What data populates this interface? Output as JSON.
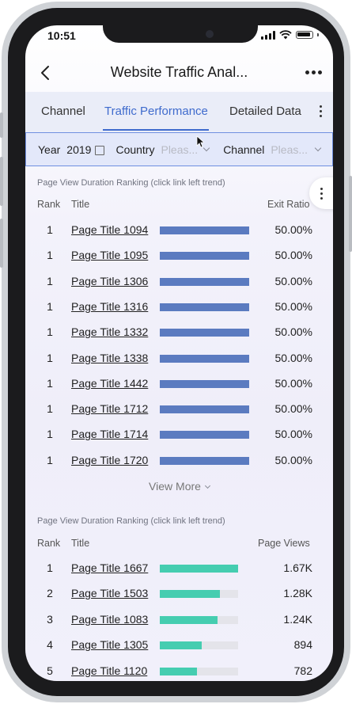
{
  "status_bar": {
    "time": "10:51"
  },
  "nav": {
    "title": "Website Traffic Anal..."
  },
  "tabs": [
    {
      "label": "Channel",
      "active": false
    },
    {
      "label": "Traffic Performance",
      "active": true
    },
    {
      "label": "Detailed Data",
      "active": false
    }
  ],
  "filters": {
    "year_label": "Year",
    "year_value": "2019",
    "country_label": "Country",
    "country_placeholder": "Pleas...",
    "channel_label": "Channel",
    "channel_placeholder": "Pleas..."
  },
  "table1": {
    "caption": "Page View Duration Ranking (click link left trend)",
    "headers": {
      "rank": "Rank",
      "title": "Title",
      "value": "Exit Ratio"
    },
    "bar_color": "#5b7bc0",
    "rows": [
      {
        "rank": "1",
        "title": "Page Title 1094",
        "value": "50.00%",
        "bar": 1.0
      },
      {
        "rank": "1",
        "title": "Page Title 1095",
        "value": "50.00%",
        "bar": 1.0
      },
      {
        "rank": "1",
        "title": "Page Title 1306",
        "value": "50.00%",
        "bar": 1.0
      },
      {
        "rank": "1",
        "title": "Page Title 1316",
        "value": "50.00%",
        "bar": 1.0
      },
      {
        "rank": "1",
        "title": "Page Title 1332",
        "value": "50.00%",
        "bar": 1.0
      },
      {
        "rank": "1",
        "title": "Page Title 1338",
        "value": "50.00%",
        "bar": 1.0
      },
      {
        "rank": "1",
        "title": "Page Title 1442",
        "value": "50.00%",
        "bar": 1.0
      },
      {
        "rank": "1",
        "title": "Page Title 1712",
        "value": "50.00%",
        "bar": 1.0
      },
      {
        "rank": "1",
        "title": "Page Title 1714",
        "value": "50.00%",
        "bar": 1.0
      },
      {
        "rank": "1",
        "title": "Page Title 1720",
        "value": "50.00%",
        "bar": 1.0
      }
    ],
    "view_more": "View More"
  },
  "table2": {
    "caption": "Page View Duration Ranking (click link left trend)",
    "headers": {
      "rank": "Rank",
      "title": "Title",
      "value": "Page Views"
    },
    "bar_color": "#45cdb0",
    "rows": [
      {
        "rank": "1",
        "title": "Page Title 1667",
        "value": "1.67K",
        "bar": 1.0
      },
      {
        "rank": "2",
        "title": "Page Title 1503",
        "value": "1.28K",
        "bar": 0.77
      },
      {
        "rank": "3",
        "title": "Page Title 1083",
        "value": "1.24K",
        "bar": 0.74
      },
      {
        "rank": "4",
        "title": "Page Title 1305",
        "value": "894",
        "bar": 0.54
      },
      {
        "rank": "5",
        "title": "Page Title 1120",
        "value": "782",
        "bar": 0.47
      }
    ]
  }
}
